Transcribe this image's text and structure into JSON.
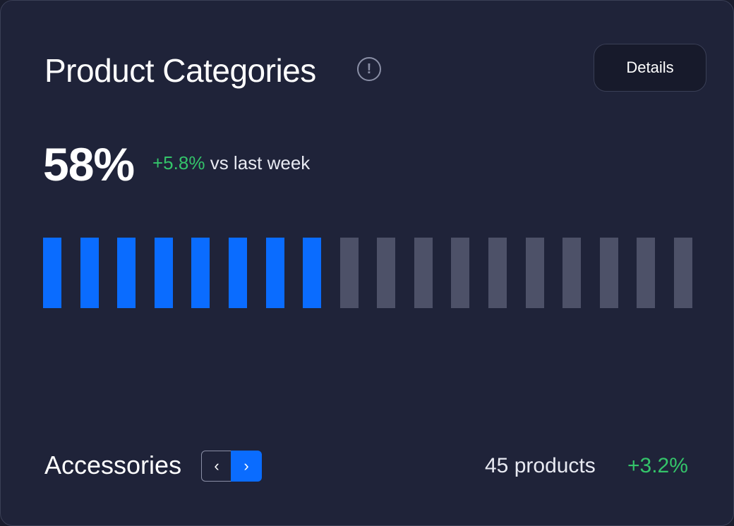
{
  "card": {
    "title": "Product Categories",
    "details_label": "Details",
    "info_icon": "info-icon"
  },
  "summary": {
    "percent": "58%",
    "delta": "+5.8%",
    "delta_suffix": "vs last week"
  },
  "progress": {
    "total_segments": 18,
    "filled_segments": 8,
    "fill_color": "#0a6cff",
    "empty_color": "#4d5168"
  },
  "footer": {
    "category": "Accessories",
    "prev_icon": "chevron-left-icon",
    "next_icon": "chevron-right-icon",
    "products": "45 products",
    "products_delta": "+3.2%"
  },
  "colors": {
    "background": "#1f2339",
    "accent": "#0a6cff",
    "positive": "#34c46a"
  }
}
